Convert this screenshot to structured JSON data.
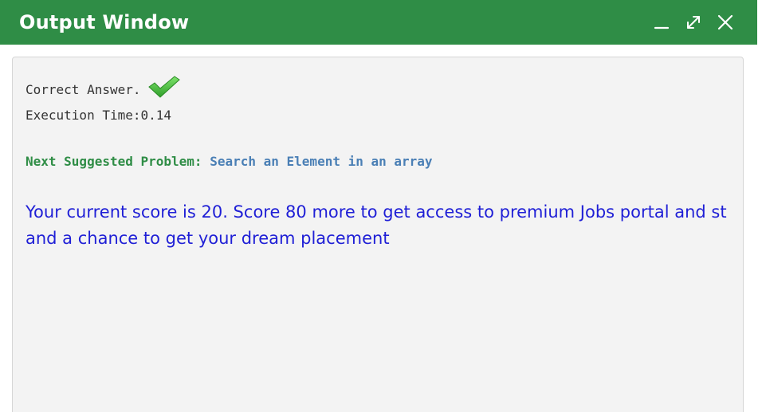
{
  "window": {
    "title": "Output Window",
    "controls": [
      "minimize-icon",
      "maximize-icon",
      "close-icon"
    ]
  },
  "output": {
    "result_text": "Correct Answer.",
    "result_icon": "checkmark-icon",
    "execution_time": "Execution Time:0.14",
    "next_label": "Next Suggested Problem:",
    "next_link": "Search an Element in an array",
    "score_message": "Your current score is 20. Score 80 more to get access to premium Jobs portal and stand a chance to get your dream placement"
  },
  "colors": {
    "header": "#2f8d46",
    "panel": "#f3f3f3",
    "next_label": "#2f8d46",
    "next_link": "#4a7fb5",
    "score_text": "#1f1fd6"
  }
}
